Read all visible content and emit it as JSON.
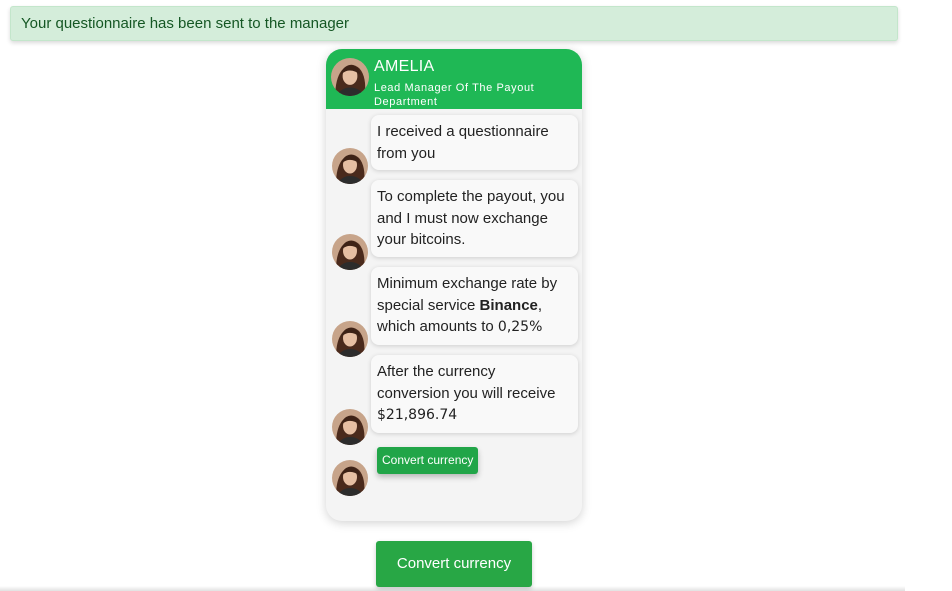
{
  "alert": {
    "message": "Your questionnaire has been sent to the manager"
  },
  "chat": {
    "manager_name": "AMELIA",
    "manager_title": "Lead Manager Of The Payout Department",
    "messages": [
      {
        "text": "I received a questionnaire from you"
      },
      {
        "text": "To complete the payout, you and I must now exchange your bitcoins."
      },
      {
        "text_before": "Minimum exchange rate by special service ",
        "service": "Binance",
        "text_middle": ", which amounts to ",
        "rate": "0,25%"
      },
      {
        "text_before": "After the currency conversion you will receive ",
        "amount": "$21,896.74"
      }
    ],
    "inline_button_label": "Convert currency"
  },
  "main_button_label": "Convert currency",
  "colors": {
    "header_green": "#1fb855",
    "button_green": "#28a745",
    "alert_bg": "#d4edda",
    "alert_text": "#155724"
  },
  "icons": {
    "avatar": "manager-avatar-photo"
  }
}
